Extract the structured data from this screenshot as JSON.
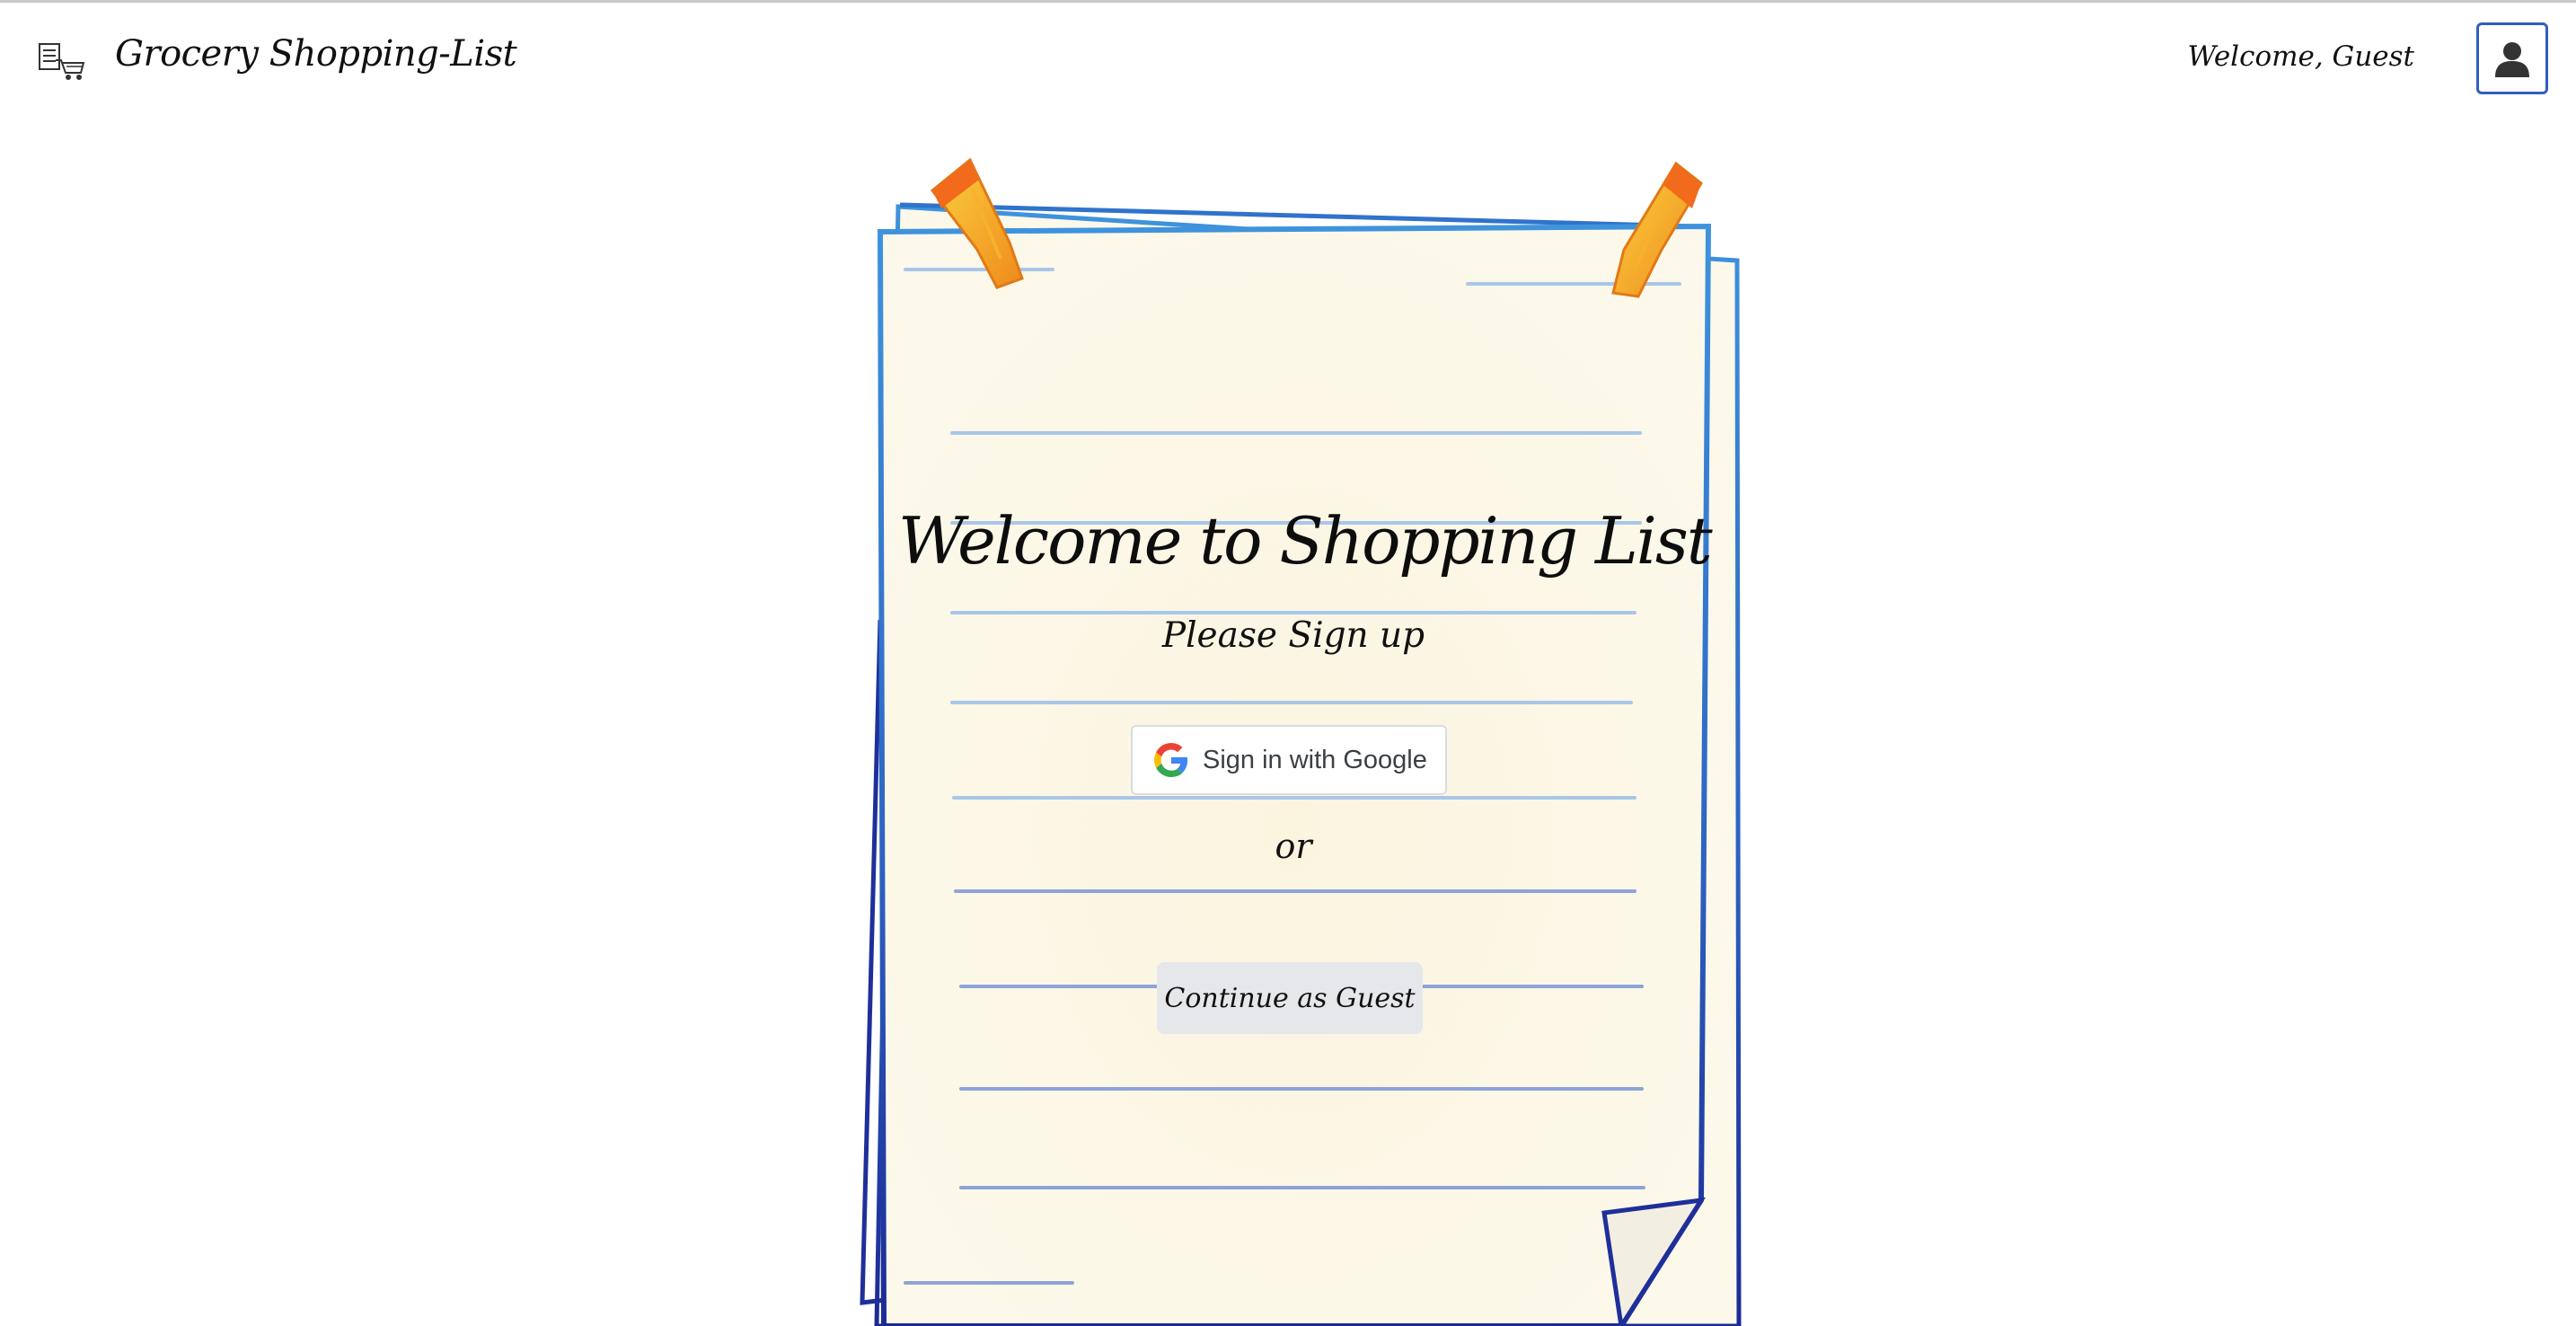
{
  "header": {
    "logo_icon": "grocery-list-cart-icon",
    "app_title": "Grocery Shopping-List",
    "welcome_text": "Welcome, Guest",
    "avatar_icon": "user-silhouette-icon"
  },
  "card": {
    "title": "Welcome to Shopping List",
    "subtitle": "Please Sign up",
    "google_button_label": "Sign in with Google",
    "google_icon": "google-g-icon",
    "divider_text": "or",
    "guest_button_label": "Continue as Guest"
  },
  "colors": {
    "paper_fill": "#fbf6e4",
    "paper_border": "#3a8ad6",
    "paper_border_dark": "#1f2f9a",
    "rule_line": "#a9c6e8",
    "clip_orange": "#f39a22",
    "avatar_border": "#2f5fbf",
    "guest_button_bg": "#e6e7eb"
  }
}
